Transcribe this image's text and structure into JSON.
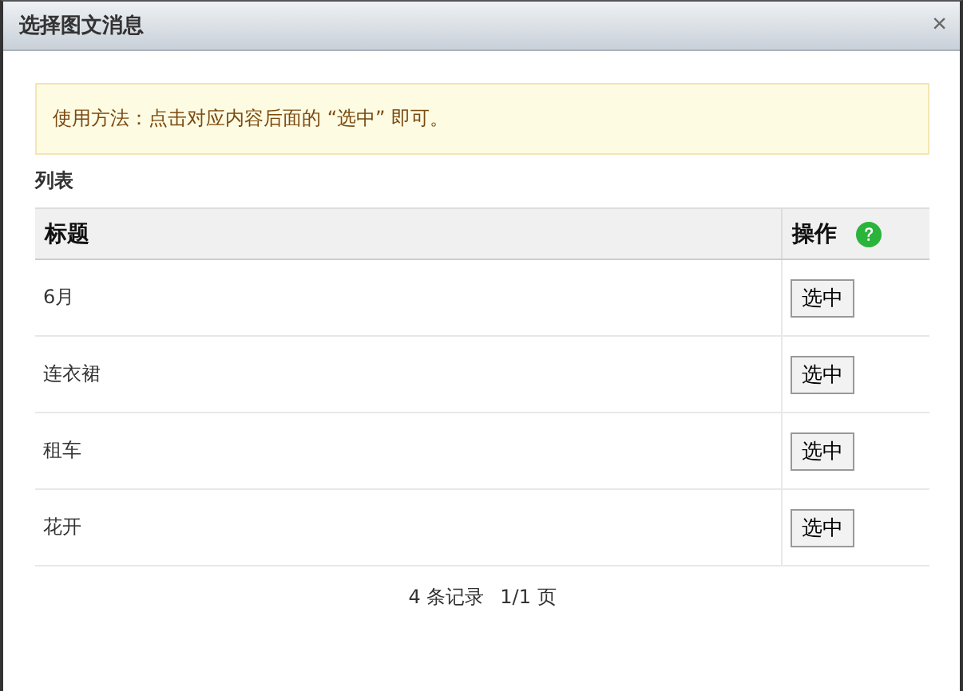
{
  "window": {
    "title": "选择图文消息",
    "close": "×"
  },
  "notice": "使用方法：点击对应内容后面的 “选中” 即可。",
  "section_label": "列表",
  "table": {
    "columns": [
      "标题",
      "操作"
    ],
    "rows": [
      {
        "title": "6月",
        "action": "选中"
      },
      {
        "title": "连衣裙",
        "action": "选中"
      },
      {
        "title": "租车",
        "action": "选中"
      },
      {
        "title": "花开",
        "action": "选中"
      }
    ]
  },
  "pagination": {
    "records": "4 条记录",
    "pages": "1/1 页"
  }
}
